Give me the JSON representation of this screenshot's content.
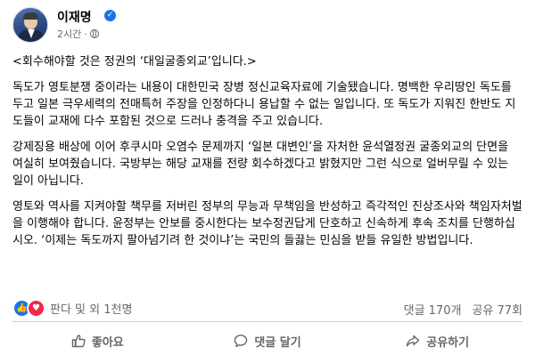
{
  "post": {
    "author": "이재명",
    "time": "2시간",
    "paragraphs": [
      "<회수해야할 것은 정권의 ‘대일굴종외교’입니다.>",
      "독도가 영토분쟁 중이라는 내용이 대한민국 장병 정신교육자료에 기술됐습니다. 명백한 우리땅인 독도를 두고 일본 극우세력의 전매특허 주장을 인정하다니 용납할 수 없는 일입니다. 또 독도가 지워진 한반도 지도들이 교재에 다수 포함된 것으로 드러나 충격을 주고 있습니다.",
      "강제징용 배상에 이어 후쿠시마 오염수 문제까지 ‘일본 대변인’을 자처한 윤석열정권 굴종외교의 단면을 여실히 보여줬습니다. 국방부는 해당 교재를 전량 회수하겠다고 밝혔지만 그런 식으로 얼버무릴 수 있는 일이 아닙니다.",
      "영토와 역사를 지켜야할 책무를 저버린 정부의 무능과 무책임을 반성하고 즉각적인 진상조사와 책임자처벌을 이행해야 합니다. 윤정부는 안보를 중시한다는 보수정권답게 단호하고 신속하게 후속 조치를 단행하십시오. ‘이제는 독도까지 팔아넘기려 한 것이냐’는 국민의 들끓는 민심을 받들 유일한 방법입니다."
    ]
  },
  "reactions": {
    "summary": "판다 및 외 1천명",
    "comments": "댓글 170개",
    "shares": "공유 77회"
  },
  "actions": {
    "like": "좋아요",
    "comment": "댓글 달기",
    "share": "공유하기"
  },
  "icons": {
    "verified": "verified-badge-icon",
    "audience": "globe-icon",
    "like": "thumbs-up-icon",
    "love": "heart-icon",
    "comment": "speech-bubble-icon",
    "share": "share-arrow-icon"
  },
  "colors": {
    "accent": "#1b74e4",
    "love": "#f0284a",
    "secondary_text": "#65676b"
  }
}
